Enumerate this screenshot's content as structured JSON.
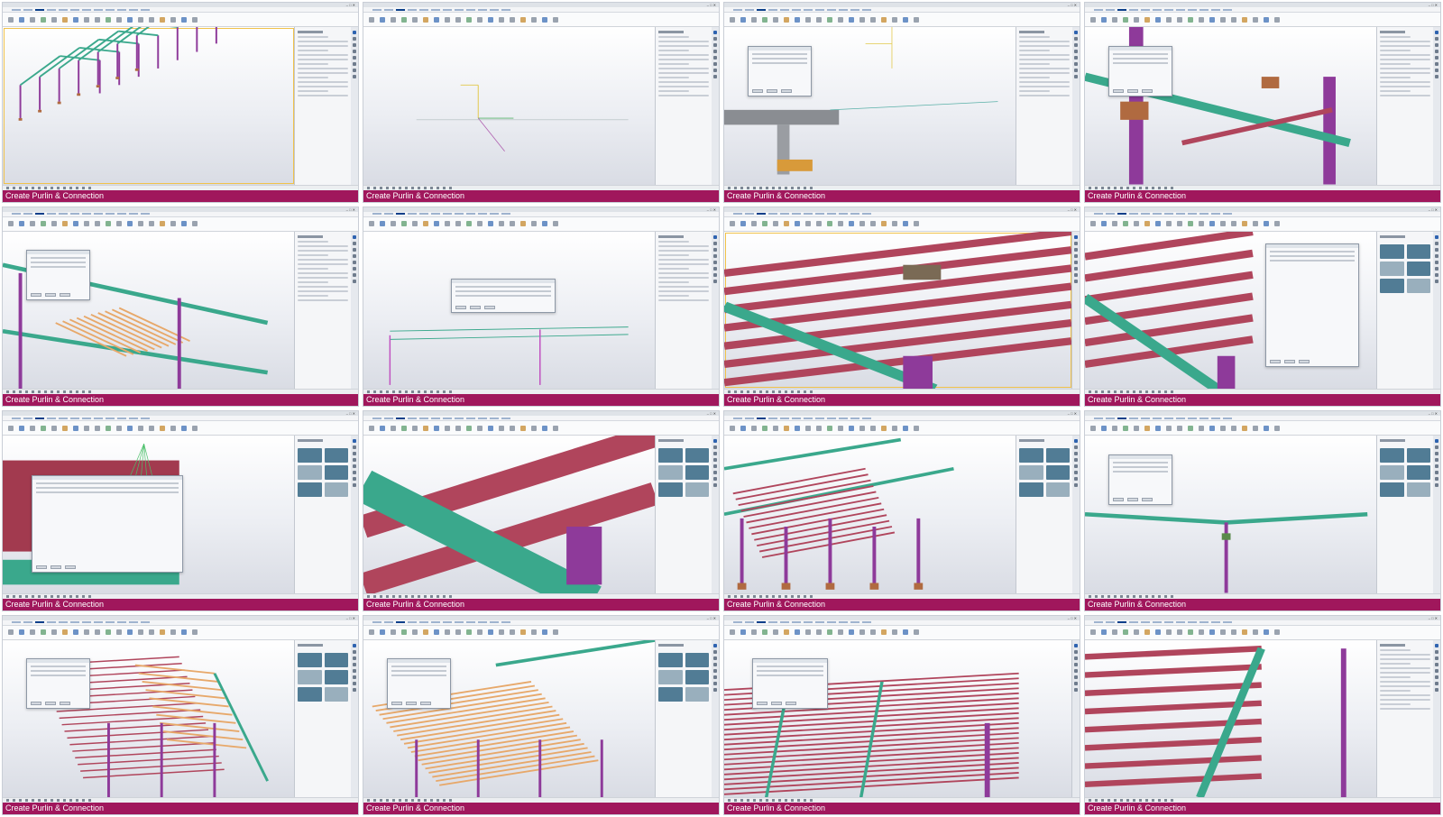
{
  "caption_text": "Create Purlin & Connection",
  "colors": {
    "caption_bg": "#a0175c",
    "column_purple": "#8e3a9a",
    "rafter_teal": "#3aa88c",
    "purlin_red": "#b0455c",
    "purlin_orange": "#e7a86a",
    "footing_brown": "#b06a40"
  },
  "tiles": [
    {
      "id": 1,
      "caption": "Create Purlin & Connection",
      "scene": "frames",
      "panel": "properties",
      "dialog": false,
      "selected": true
    },
    {
      "id": 2,
      "caption": "Create Purlin & Connection",
      "scene": "elevation-lines",
      "panel": "properties",
      "dialog": false,
      "selected": false
    },
    {
      "id": 3,
      "caption": "Create Purlin & Connection",
      "scene": "section-gray",
      "panel": "properties",
      "dialog": true,
      "selected": false
    },
    {
      "id": 4,
      "caption": "Create Purlin & Connection",
      "scene": "closeup-beam",
      "panel": "properties",
      "dialog": true,
      "selected": false
    },
    {
      "id": 5,
      "caption": "Create Purlin & Connection",
      "scene": "bay-purlins",
      "panel": "properties",
      "dialog": true,
      "selected": false
    },
    {
      "id": 6,
      "caption": "Create Purlin & Connection",
      "scene": "elevation-warning",
      "panel": "properties",
      "dialog": true,
      "selected": false
    },
    {
      "id": 7,
      "caption": "Create Purlin & Connection",
      "scene": "purlins-closeup",
      "panel": "none",
      "dialog": false,
      "selected": true
    },
    {
      "id": 8,
      "caption": "Create Purlin & Connection",
      "scene": "purlins-connection-dialog",
      "panel": "catalog",
      "dialog": true,
      "selected": false
    },
    {
      "id": 9,
      "caption": "Create Purlin & Connection",
      "scene": "connection-editor",
      "panel": "catalog",
      "dialog": true,
      "selected": false
    },
    {
      "id": 10,
      "caption": "Create Purlin & Connection",
      "scene": "purlin-detail",
      "panel": "catalog",
      "dialog": false,
      "selected": false
    },
    {
      "id": 11,
      "caption": "Create Purlin & Connection",
      "scene": "two-bays",
      "panel": "catalog",
      "dialog": false,
      "selected": false
    },
    {
      "id": 12,
      "caption": "Create Purlin & Connection",
      "scene": "elevation-rafter",
      "panel": "catalog",
      "dialog": true,
      "selected": false
    },
    {
      "id": 13,
      "caption": "Create Purlin & Connection",
      "scene": "roof-iso-left",
      "panel": "catalog",
      "dialog": true,
      "selected": false
    },
    {
      "id": 14,
      "caption": "Create Purlin & Connection",
      "scene": "roof-iso-mid",
      "panel": "catalog",
      "dialog": true,
      "selected": false
    },
    {
      "id": 15,
      "caption": "Create Purlin & Connection",
      "scene": "roof-full",
      "panel": "none",
      "dialog": true,
      "selected": false
    },
    {
      "id": 16,
      "caption": "Create Purlin & Connection",
      "scene": "purlins-edge",
      "panel": "properties",
      "dialog": false,
      "selected": false
    }
  ]
}
